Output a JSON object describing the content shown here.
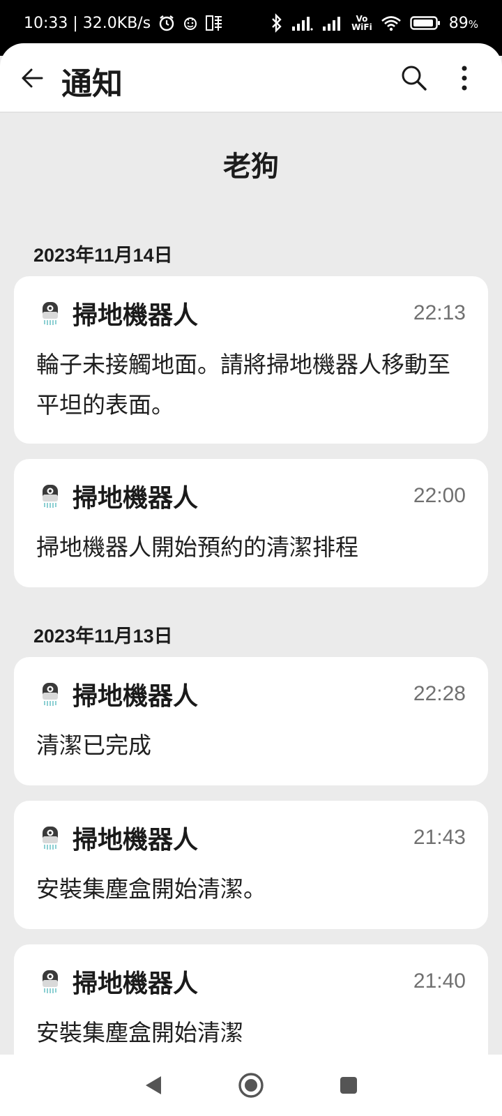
{
  "status_bar": {
    "time_speed": "10:33 | 32.0KB/s",
    "battery_percent": "89",
    "battery_unit": "%",
    "vowifi_top": "Vo",
    "vowifi_bottom": "WiFi",
    "icons": [
      "alarm-icon",
      "face-icon",
      "app-notification-icon",
      "bluetooth-icon",
      "signal-icon",
      "signal-icon",
      "vowifi-icon",
      "wifi-icon",
      "battery-icon"
    ]
  },
  "app_bar": {
    "title": "通知",
    "icons": [
      "back-arrow-icon",
      "search-icon",
      "more-vert-icon"
    ]
  },
  "device_name": "老狗",
  "groups": [
    {
      "date": "2023年11月14日",
      "notifications": [
        {
          "app": "掃地機器人",
          "time": "22:13",
          "message": "輪子未接觸地面。請將掃地機器人移動至平坦的表面。"
        },
        {
          "app": "掃地機器人",
          "time": "22:00",
          "message": "掃地機器人開始預約的清潔排程"
        }
      ]
    },
    {
      "date": "2023年11月13日",
      "notifications": [
        {
          "app": "掃地機器人",
          "time": "22:28",
          "message": "清潔已完成"
        },
        {
          "app": "掃地機器人",
          "time": "21:43",
          "message": "安裝集塵盒開始清潔。"
        },
        {
          "app": "掃地機器人",
          "time": "21:40",
          "message": "安裝集塵盒開始清潔"
        }
      ]
    }
  ],
  "nav_bar": {
    "icons": [
      "nav-back-icon",
      "nav-home-icon",
      "nav-recents-icon"
    ]
  },
  "colors": {
    "background": "#ebebeb",
    "card": "#ffffff",
    "text_primary": "#1a1a1a",
    "text_secondary": "#707070"
  }
}
